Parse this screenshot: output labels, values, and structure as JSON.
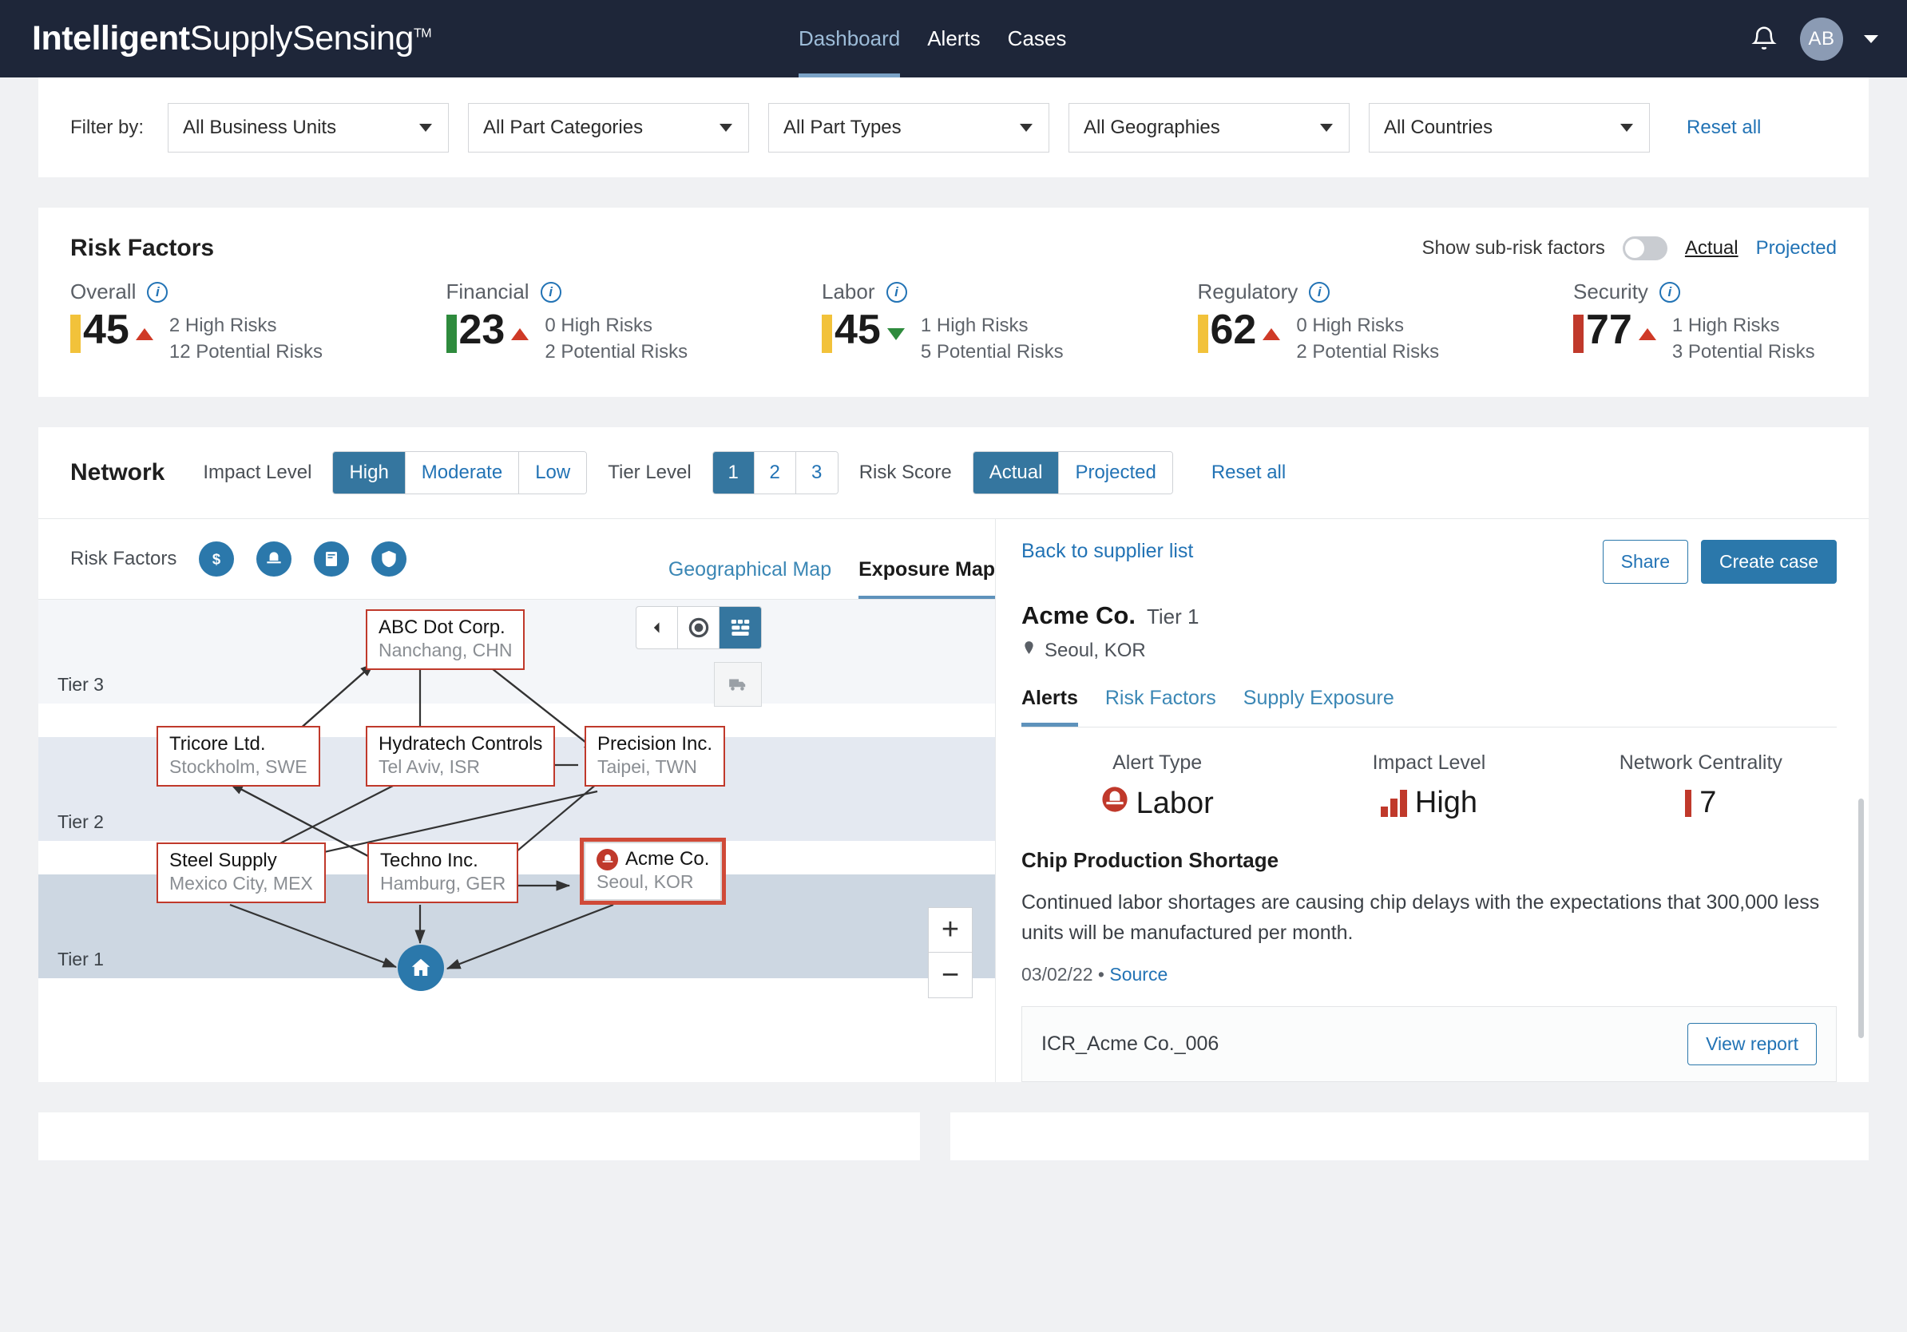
{
  "header": {
    "logo_bold": "Intelligent",
    "logo_normal": "SupplySensing",
    "logo_tm": "TM",
    "nav": [
      {
        "label": "Dashboard",
        "active": true
      },
      {
        "label": "Alerts",
        "active": false
      },
      {
        "label": "Cases",
        "active": false
      }
    ],
    "avatar_initials": "AB",
    "bell_icon": "bell-icon"
  },
  "filters": {
    "label": "Filter by:",
    "selects": [
      {
        "value": "All Business Units"
      },
      {
        "value": "All Part Categories"
      },
      {
        "value": "All Part Types"
      },
      {
        "value": "All Geographies"
      },
      {
        "value": "All Countries"
      }
    ],
    "reset": "Reset all"
  },
  "risk_factors": {
    "title": "Risk Factors",
    "sub_toggle_label": "Show sub-risk factors",
    "actual": "Actual",
    "projected": "Projected",
    "items": [
      {
        "name": "Overall",
        "score": "45",
        "bar_color": "#f2c23a",
        "trend": "up",
        "high": "2 High Risks",
        "potential": "12 Potential Risks"
      },
      {
        "name": "Financial",
        "score": "23",
        "bar_color": "#2e8b3d",
        "trend": "up",
        "high": "0 High Risks",
        "potential": "2 Potential Risks"
      },
      {
        "name": "Labor",
        "score": "45",
        "bar_color": "#f2c23a",
        "trend": "down",
        "high": "1 High Risks",
        "potential": "5 Potential Risks"
      },
      {
        "name": "Regulatory",
        "score": "62",
        "bar_color": "#f2c23a",
        "trend": "up",
        "high": "0 High Risks",
        "potential": "2 Potential Risks"
      },
      {
        "name": "Security",
        "score": "77",
        "bar_color": "#c0392b",
        "trend": "up",
        "high": "1 High Risks",
        "potential": "3 Potential Risks"
      }
    ]
  },
  "network": {
    "title": "Network",
    "impact_label": "Impact Level",
    "impact_options": [
      {
        "label": "High",
        "on": true
      },
      {
        "label": "Moderate",
        "on": false
      },
      {
        "label": "Low",
        "on": false
      }
    ],
    "tier_label": "Tier Level",
    "tier_options": [
      {
        "label": "1",
        "on": true
      },
      {
        "label": "2",
        "on": false
      },
      {
        "label": "3",
        "on": false
      }
    ],
    "risk_score_label": "Risk Score",
    "risk_score_options": [
      {
        "label": "Actual",
        "on": true
      },
      {
        "label": "Projected",
        "on": false
      }
    ],
    "reset": "Reset all",
    "risk_factor_label": "Risk Factors",
    "risk_factor_icons": [
      "dollar-icon",
      "hardhat-icon",
      "document-icon",
      "shield-icon"
    ],
    "map_tabs": [
      {
        "label": "Geographical Map",
        "on": false
      },
      {
        "label": "Exposure Map",
        "on": true
      }
    ],
    "tiers": [
      {
        "label": "Tier 3"
      },
      {
        "label": "Tier 2"
      },
      {
        "label": "Tier 1"
      }
    ],
    "nodes": [
      {
        "name": "ABC Dot Corp.",
        "location": "Nanchang, CHN",
        "selected": false,
        "icon": null
      },
      {
        "name": "Tricore Ltd.",
        "location": "Stockholm, SWE",
        "selected": false,
        "icon": null
      },
      {
        "name": "Hydratech Controls",
        "location": "Tel Aviv, ISR",
        "selected": false,
        "icon": null
      },
      {
        "name": "Precision Inc.",
        "location": "Taipei, TWN",
        "selected": false,
        "icon": null
      },
      {
        "name": "Steel Supply",
        "location": "Mexico City, MEX",
        "selected": false,
        "icon": null
      },
      {
        "name": "Techno Inc.",
        "location": "Hamburg, GER",
        "selected": false,
        "icon": null
      },
      {
        "name": "Acme Co.",
        "location": "Seoul, KOR",
        "selected": true,
        "icon": "hardhat-icon"
      }
    ],
    "zoom_in": "+",
    "zoom_out": "−"
  },
  "detail": {
    "back_link": "Back to supplier list",
    "share": "Share",
    "create_case": "Create case",
    "supplier_name": "Acme Co.",
    "tier": "Tier 1",
    "location": "Seoul, KOR",
    "tabs": [
      {
        "label": "Alerts",
        "on": true
      },
      {
        "label": "Risk Factors",
        "on": false
      },
      {
        "label": "Supply Exposure",
        "on": false
      }
    ],
    "stats": [
      {
        "header": "Alert Type",
        "value": "Labor"
      },
      {
        "header": "Impact Level",
        "value": "High"
      },
      {
        "header": "Network Centrality",
        "value": "7"
      }
    ],
    "alert_title": "Chip Production Shortage",
    "alert_text": "Continued labor shortages are causing chip delays with the expectations that 300,000 less units will be manufactured per month.",
    "alert_date": "03/02/22",
    "alert_source": "Source",
    "report_id": "ICR_Acme Co._006",
    "view_report": "View report"
  },
  "colors": {
    "brand_dark": "#1e2639",
    "accent_blue": "#2b78ab",
    "danger_red": "#c0392b",
    "warn_yellow": "#f2c23a",
    "ok_green": "#2e8b3d"
  }
}
